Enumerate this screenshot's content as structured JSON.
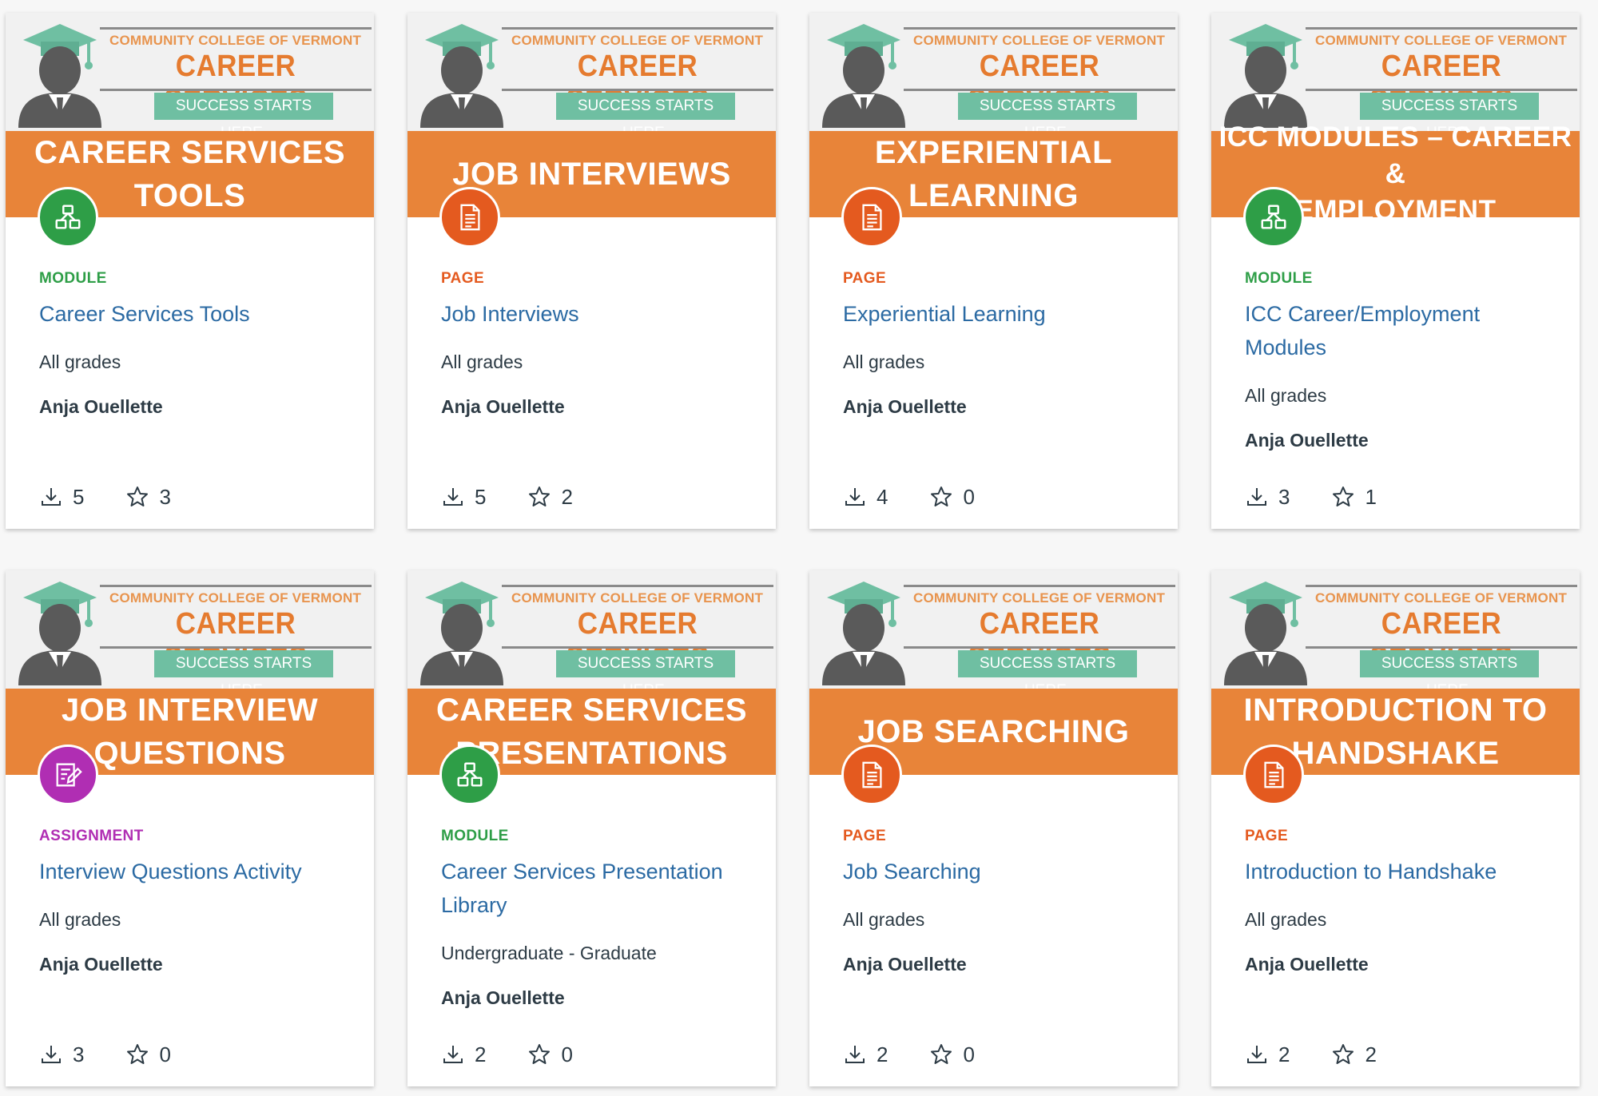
{
  "banner": {
    "college": "COMMUNITY COLLEGE OF VERMONT",
    "service": "CAREER SERVICES",
    "tagline": "SUCCESS STARTS HERE."
  },
  "colors": {
    "module": "#2e9e47",
    "page": "#e45a1f",
    "assignment": "#b02eb3",
    "banner_orange": "#e88439",
    "link_blue": "#2b6aa3"
  },
  "cards": [
    {
      "banner_title": "CAREER SERVICES\nTOOLS",
      "icon": "module-icon",
      "type": "MODULE",
      "title": "Career Services Tools",
      "grades": "All grades",
      "author": "Anja Ouellette",
      "downloads": "5",
      "favorites": "3"
    },
    {
      "banner_title": "JOB INTERVIEWS",
      "icon": "page-icon",
      "type": "PAGE",
      "title": "Job Interviews",
      "grades": "All grades",
      "author": "Anja Ouellette",
      "downloads": "5",
      "favorites": "2"
    },
    {
      "banner_title": "EXPERIENTIAL\nLEARNING",
      "icon": "page-icon",
      "type": "PAGE",
      "title": "Experiential Learning",
      "grades": "All grades",
      "author": "Anja Ouellette",
      "downloads": "4",
      "favorites": "0"
    },
    {
      "banner_title": "ICC MODULES – CAREER &\nEMPLOYMENT",
      "icon": "module-icon",
      "type": "MODULE",
      "title": "ICC Career/Employment Modules",
      "grades": "All grades",
      "author": "Anja Ouellette",
      "downloads": "3",
      "favorites": "1"
    },
    {
      "banner_title": "JOB INTERVIEW\nQUESTIONS",
      "icon": "assignment-icon",
      "type": "ASSIGNMENT",
      "title": "Interview Questions Activity",
      "grades": "All grades",
      "author": "Anja Ouellette",
      "downloads": "3",
      "favorites": "0"
    },
    {
      "banner_title": "CAREER SERVICES\nPRESENTATIONS",
      "icon": "module-icon",
      "type": "MODULE",
      "title": "Career Services Presentation Library",
      "grades": "Undergraduate - Graduate",
      "author": "Anja Ouellette",
      "downloads": "2",
      "favorites": "0"
    },
    {
      "banner_title": "JOB SEARCHING",
      "icon": "page-icon",
      "type": "PAGE",
      "title": "Job Searching",
      "grades": "All grades",
      "author": "Anja Ouellette",
      "downloads": "2",
      "favorites": "0"
    },
    {
      "banner_title": "INTRODUCTION TO\nHANDSHAKE",
      "icon": "page-icon",
      "type": "PAGE",
      "title": "Introduction to Handshake",
      "grades": "All grades",
      "author": "Anja Ouellette",
      "downloads": "2",
      "favorites": "2"
    }
  ]
}
